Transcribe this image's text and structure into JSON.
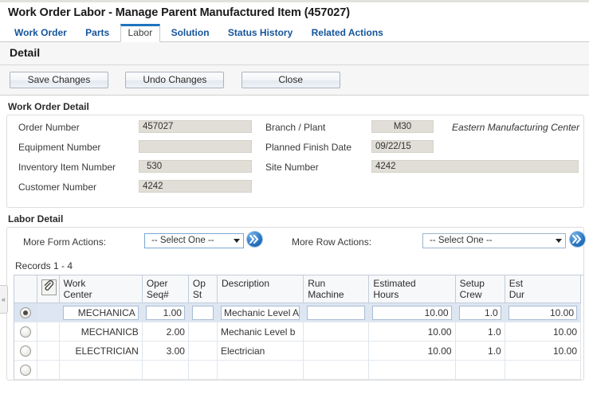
{
  "page": {
    "title": "Work Order Labor - Manage Parent Manufactured Item (457027)"
  },
  "tabs": [
    {
      "label": "Work Order",
      "active": false
    },
    {
      "label": "Parts",
      "active": false
    },
    {
      "label": "Labor",
      "active": true
    },
    {
      "label": "Solution",
      "active": false
    },
    {
      "label": "Status History",
      "active": false
    },
    {
      "label": "Related Actions",
      "active": false
    }
  ],
  "detail": {
    "heading": "Detail",
    "buttons": {
      "save": "Save Changes",
      "undo": "Undo Changes",
      "close": "Close"
    }
  },
  "work_order_detail": {
    "section_title": "Work Order Detail",
    "order_number_label": "Order Number",
    "order_number_value": "457027",
    "equipment_number_label": "Equipment Number",
    "equipment_number_value": "",
    "inventory_item_label": "Inventory Item Number",
    "inventory_item_value": "530",
    "customer_number_label": "Customer Number",
    "customer_number_value": "4242",
    "branch_plant_label": "Branch / Plant",
    "branch_plant_value": "M30",
    "branch_plant_note": "Eastern Manufacturing Center",
    "planned_finish_label": "Planned Finish Date",
    "planned_finish_value": "09/22/15",
    "site_number_label": "Site Number",
    "site_number_value": "4242"
  },
  "labor_detail": {
    "section_title": "Labor Detail",
    "form_actions_label": "More Form Actions:",
    "form_actions_value": "-- Select One --",
    "row_actions_label": "More Row Actions:",
    "row_actions_value": "-- Select One --",
    "go_icon": "double-chevron-right-icon",
    "records_text": "Records 1 - 4",
    "collapse_handle": "«",
    "attachment_icon": "paperclip-icon",
    "columns": [
      "Work Center",
      "Oper Seq#",
      "Op St",
      "Description",
      "Run Machine",
      "Estimated Hours",
      "Setup Crew",
      "Est Dur"
    ],
    "columns_lines": [
      [
        "Work",
        "Center"
      ],
      [
        "Oper",
        "Seq#"
      ],
      [
        "Op",
        "St"
      ],
      [
        "Description",
        ""
      ],
      [
        "Run",
        "Machine"
      ],
      [
        "Estimated",
        "Hours"
      ],
      [
        "Setup",
        "Crew"
      ],
      [
        "Est",
        "Dur"
      ]
    ],
    "rows": [
      {
        "selected": true,
        "editable": true,
        "work_center": "MECHANICA",
        "oper_seq": "1.00",
        "op_st": "",
        "description": "Mechanic Level A",
        "run_machine": "",
        "estimated_hours": "10.00",
        "setup_crew": "1.0",
        "est_dur": "10.00"
      },
      {
        "selected": false,
        "editable": false,
        "work_center": "MECHANICB",
        "oper_seq": "2.00",
        "op_st": "",
        "description": "Mechanic Level b",
        "run_machine": "",
        "estimated_hours": "10.00",
        "setup_crew": "1.0",
        "est_dur": "10.00"
      },
      {
        "selected": false,
        "editable": false,
        "work_center": "ELECTRICIAN",
        "oper_seq": "3.00",
        "op_st": "",
        "description": "Electrician",
        "run_machine": "",
        "estimated_hours": "10.00",
        "setup_crew": "1.0",
        "est_dur": "10.00"
      }
    ]
  },
  "colors": {
    "tab_active_accent": "#1f74bd",
    "link_blue": "#15559a",
    "field_fill": "#e0ded6",
    "row_selected": "#dde6f2"
  }
}
